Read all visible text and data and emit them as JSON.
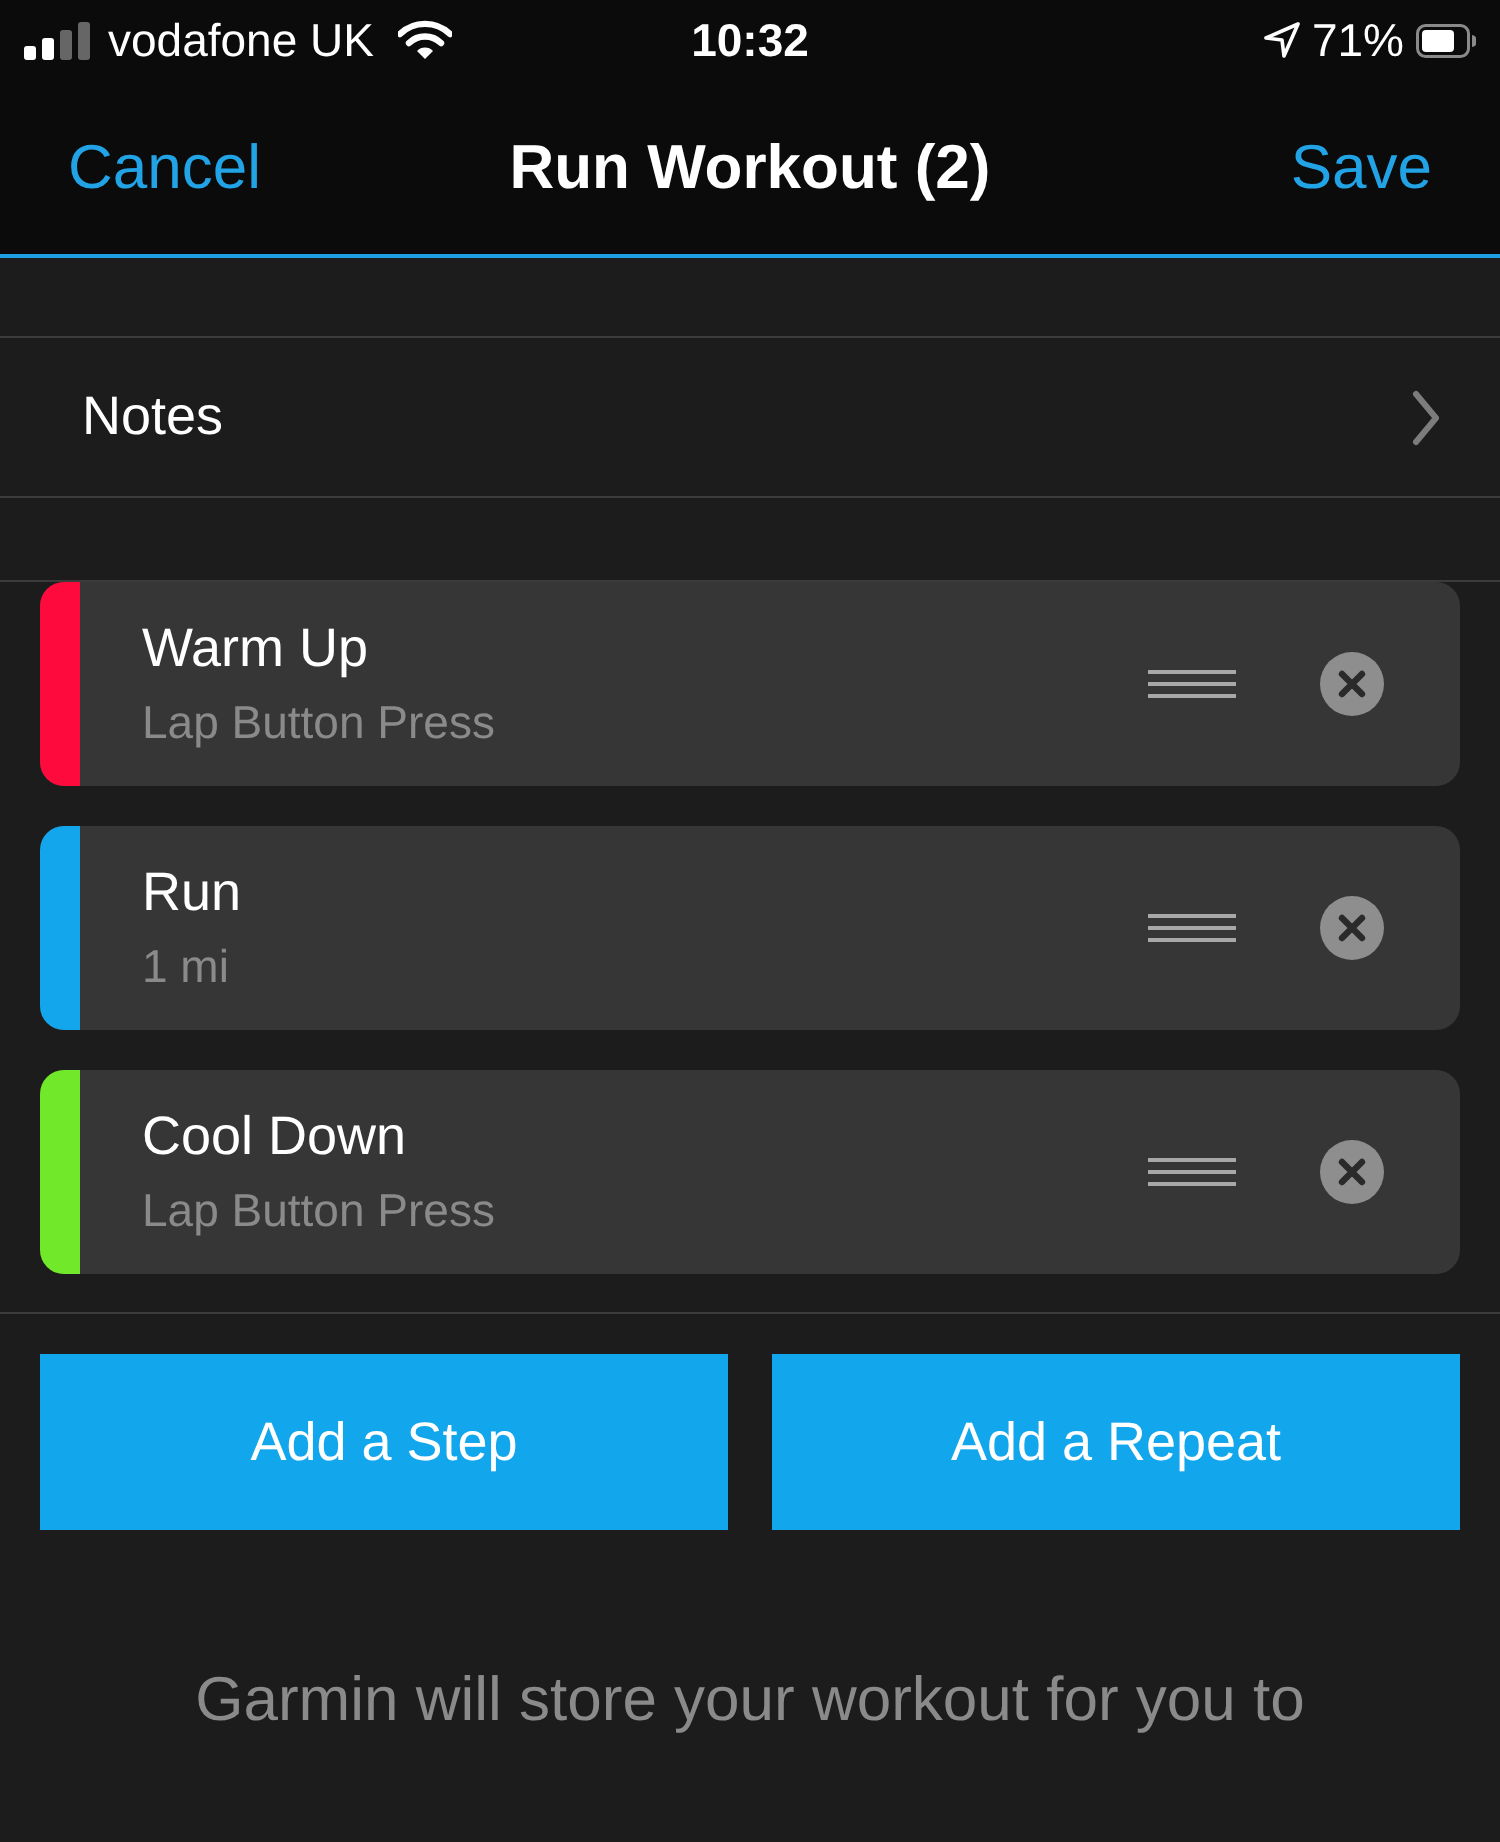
{
  "status_bar": {
    "carrier": "vodafone UK",
    "time": "10:32",
    "battery": "71%"
  },
  "nav": {
    "cancel": "Cancel",
    "title": "Run Workout (2)",
    "save": "Save"
  },
  "notes_row": {
    "label": "Notes"
  },
  "steps": [
    {
      "title": "Warm Up",
      "detail": "Lap Button Press",
      "color": "#ff0a3c"
    },
    {
      "title": "Run",
      "detail": "1 mi",
      "color": "#13a6ec"
    },
    {
      "title": "Cool Down",
      "detail": "Lap Button Press",
      "color": "#72e82a"
    }
  ],
  "buttons": [
    "Add a Step",
    "Add a Repeat"
  ],
  "footer_text": "Garmin will store your workout for you to"
}
